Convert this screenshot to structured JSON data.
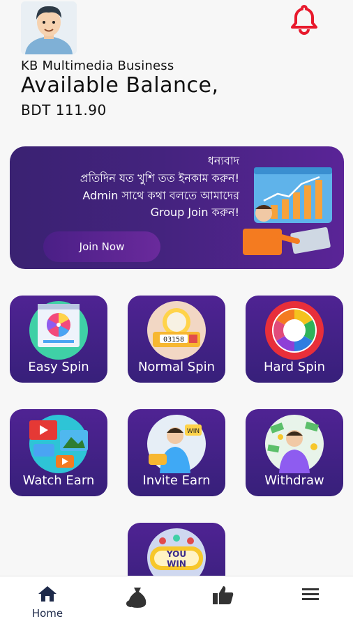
{
  "header": {
    "business_name": "KB Multimedia Business",
    "balance_title": "Available Balance,",
    "balance_amount": "BDT 111.90",
    "bell_color": "#e8192c"
  },
  "banner": {
    "lines": [
      "ধন্যবাদ",
      "প্রতিদিন যত খুশি তত ইনকাম করুন!",
      "Admin সাথে কথা বলতে আমাদের",
      "Group Join করুন!"
    ],
    "button_label": "Join Now"
  },
  "tiles": [
    {
      "label": "Easy Spin",
      "icon": "easy-spin-icon"
    },
    {
      "label": "Normal Spin",
      "icon": "normal-spin-icon"
    },
    {
      "label": "Hard Spin",
      "icon": "hard-spin-icon"
    },
    {
      "label": "Watch Earn",
      "icon": "watch-earn-icon"
    },
    {
      "label": "Invite Earn",
      "icon": "invite-earn-icon"
    },
    {
      "label": "Withdraw",
      "icon": "withdraw-icon"
    },
    {
      "label": "",
      "icon": "you-win-icon",
      "badge_text": "YOU WIN"
    }
  ],
  "bottom_nav": {
    "items": [
      {
        "label": "Home",
        "icon": "home-icon",
        "active": true
      },
      {
        "label": "",
        "icon": "money-bag-icon"
      },
      {
        "label": "",
        "icon": "thumbs-up-icon"
      },
      {
        "label": "",
        "icon": "menu-icon"
      }
    ]
  },
  "colors": {
    "tile_top": "#4f2393",
    "tile_bottom": "#37207a",
    "accent": "#e8192c",
    "nav_icon": "#1e2a4a"
  }
}
